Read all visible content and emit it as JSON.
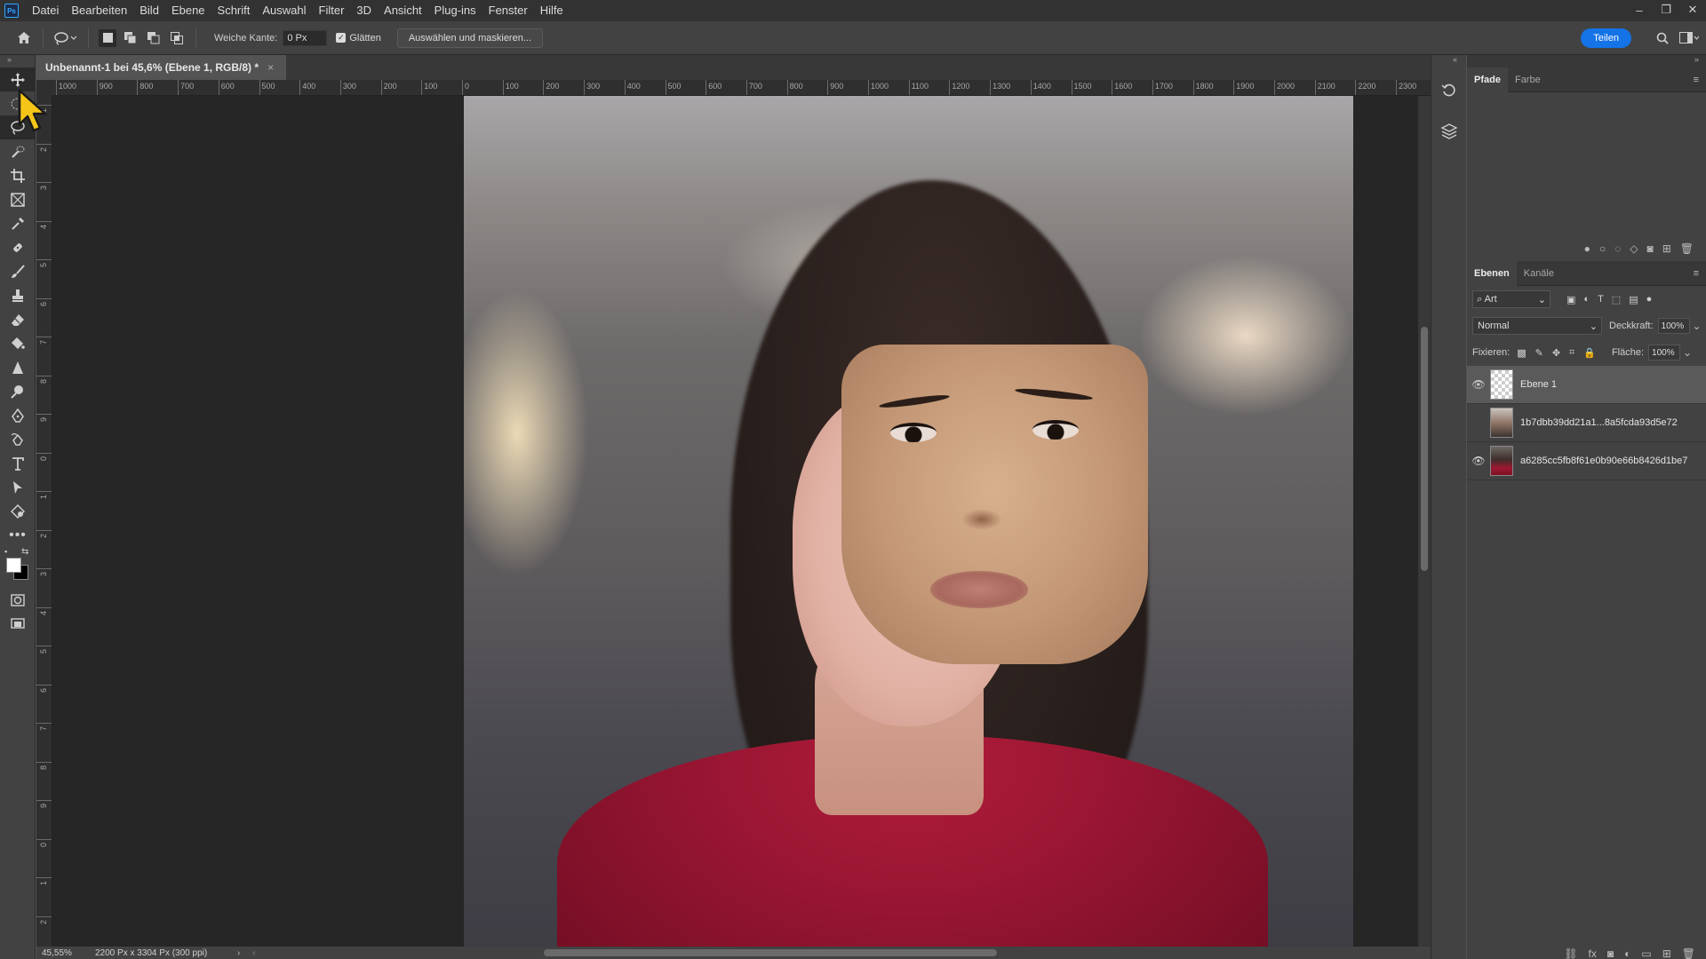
{
  "app": {
    "logo": "Ps"
  },
  "menu": [
    "Datei",
    "Bearbeiten",
    "Bild",
    "Ebene",
    "Schrift",
    "Auswahl",
    "Filter",
    "3D",
    "Ansicht",
    "Plug-ins",
    "Fenster",
    "Hilfe"
  ],
  "window_controls": {
    "minimize": "–",
    "restore": "❐",
    "close": "✕"
  },
  "options": {
    "feather_label": "Weiche Kante:",
    "feather_value": "0 Px",
    "smooth_label": "Glätten",
    "select_mask_label": "Auswählen und maskieren...",
    "share_label": "Teilen"
  },
  "document": {
    "tab_title": "Unbenannt-1 bei 45,6% (Ebene 1, RGB/8) *",
    "zoom": "45,55%",
    "size_info": "2200 Px x 3304 Px (300 ppi)"
  },
  "ruler_h": [
    "1000",
    "900",
    "800",
    "700",
    "600",
    "500",
    "400",
    "300",
    "200",
    "100",
    "0",
    "100",
    "200",
    "300",
    "400",
    "500",
    "600",
    "700",
    "800",
    "900",
    "1000",
    "1100",
    "1200",
    "1300",
    "1400",
    "1500",
    "1600",
    "1700",
    "1800",
    "1900",
    "2000",
    "2100",
    "2200",
    "2300"
  ],
  "ruler_v": [
    "1",
    "2",
    "3",
    "4",
    "5",
    "6",
    "7",
    "8",
    "9",
    "0",
    "1",
    "2",
    "3",
    "4",
    "5",
    "6",
    "7",
    "8",
    "9",
    "0",
    "1",
    "2"
  ],
  "tools": [
    "move-tool",
    "marquee-tool",
    "lasso-tool",
    "quick-selection-tool",
    "crop-tool",
    "frame-tool",
    "eyedropper-tool",
    "healing-brush-tool",
    "brush-tool",
    "clone-stamp-tool",
    "eraser-tool",
    "paint-bucket-tool",
    "sharpen-tool",
    "dodge-tool",
    "pen-tool",
    "freeform-pen-tool",
    "type-tool",
    "path-selection-tool",
    "shape-tool",
    "more-tools"
  ],
  "colors": {
    "foreground": "#ffffff",
    "background": "#000000",
    "accent": "#1473e6"
  },
  "panels": {
    "top_tabs": [
      "Pfade",
      "Farbe"
    ],
    "layers_tabs": [
      "Ebenen",
      "Kanäle"
    ],
    "filter_kind": "Art",
    "blend_mode": "Normal",
    "opacity_label": "Deckkraft:",
    "opacity_value": "100%",
    "lock_label": "Fixieren:",
    "fill_label": "Fläche:",
    "fill_value": "100%",
    "layers": [
      {
        "name": "Ebene 1",
        "visible": true,
        "selected": true
      },
      {
        "name": "1b7dbb39dd21a1...8a5fcda93d5e72",
        "visible": false,
        "selected": false
      },
      {
        "name": "a6285cc5fb8f61e0b90e66b8426d1be7",
        "visible": true,
        "selected": false
      }
    ]
  }
}
